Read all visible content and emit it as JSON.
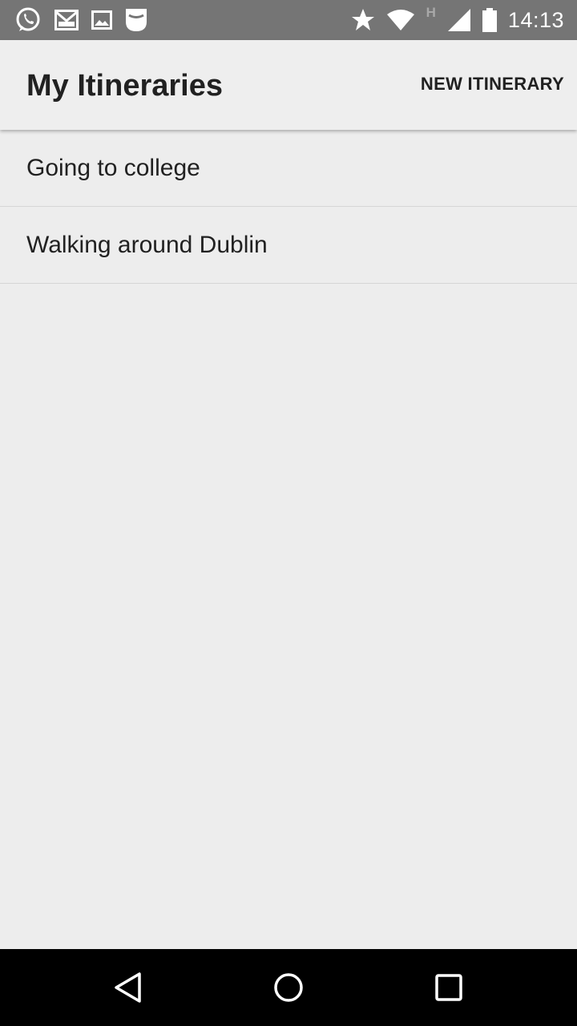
{
  "status_bar": {
    "time": "14:13",
    "network_type": "H",
    "left_icons": [
      "whatsapp-icon",
      "gmail-icon",
      "gallery-icon",
      "shield-app-icon"
    ],
    "right_icons": [
      "star-icon",
      "wifi-icon",
      "network-h-icon",
      "signal-icon",
      "battery-icon"
    ]
  },
  "app_bar": {
    "title": "My Itineraries",
    "action_label": "NEW ITINERARY"
  },
  "itineraries": [
    {
      "name": "Going to college"
    },
    {
      "name": "Walking around Dublin"
    }
  ],
  "nav_bar": {
    "buttons": [
      "back-icon",
      "home-icon",
      "recents-icon"
    ]
  },
  "colors": {
    "status_bar_bg": "#757575",
    "app_bg": "#ededed",
    "text": "#212121",
    "nav_bar_bg": "#000000"
  }
}
